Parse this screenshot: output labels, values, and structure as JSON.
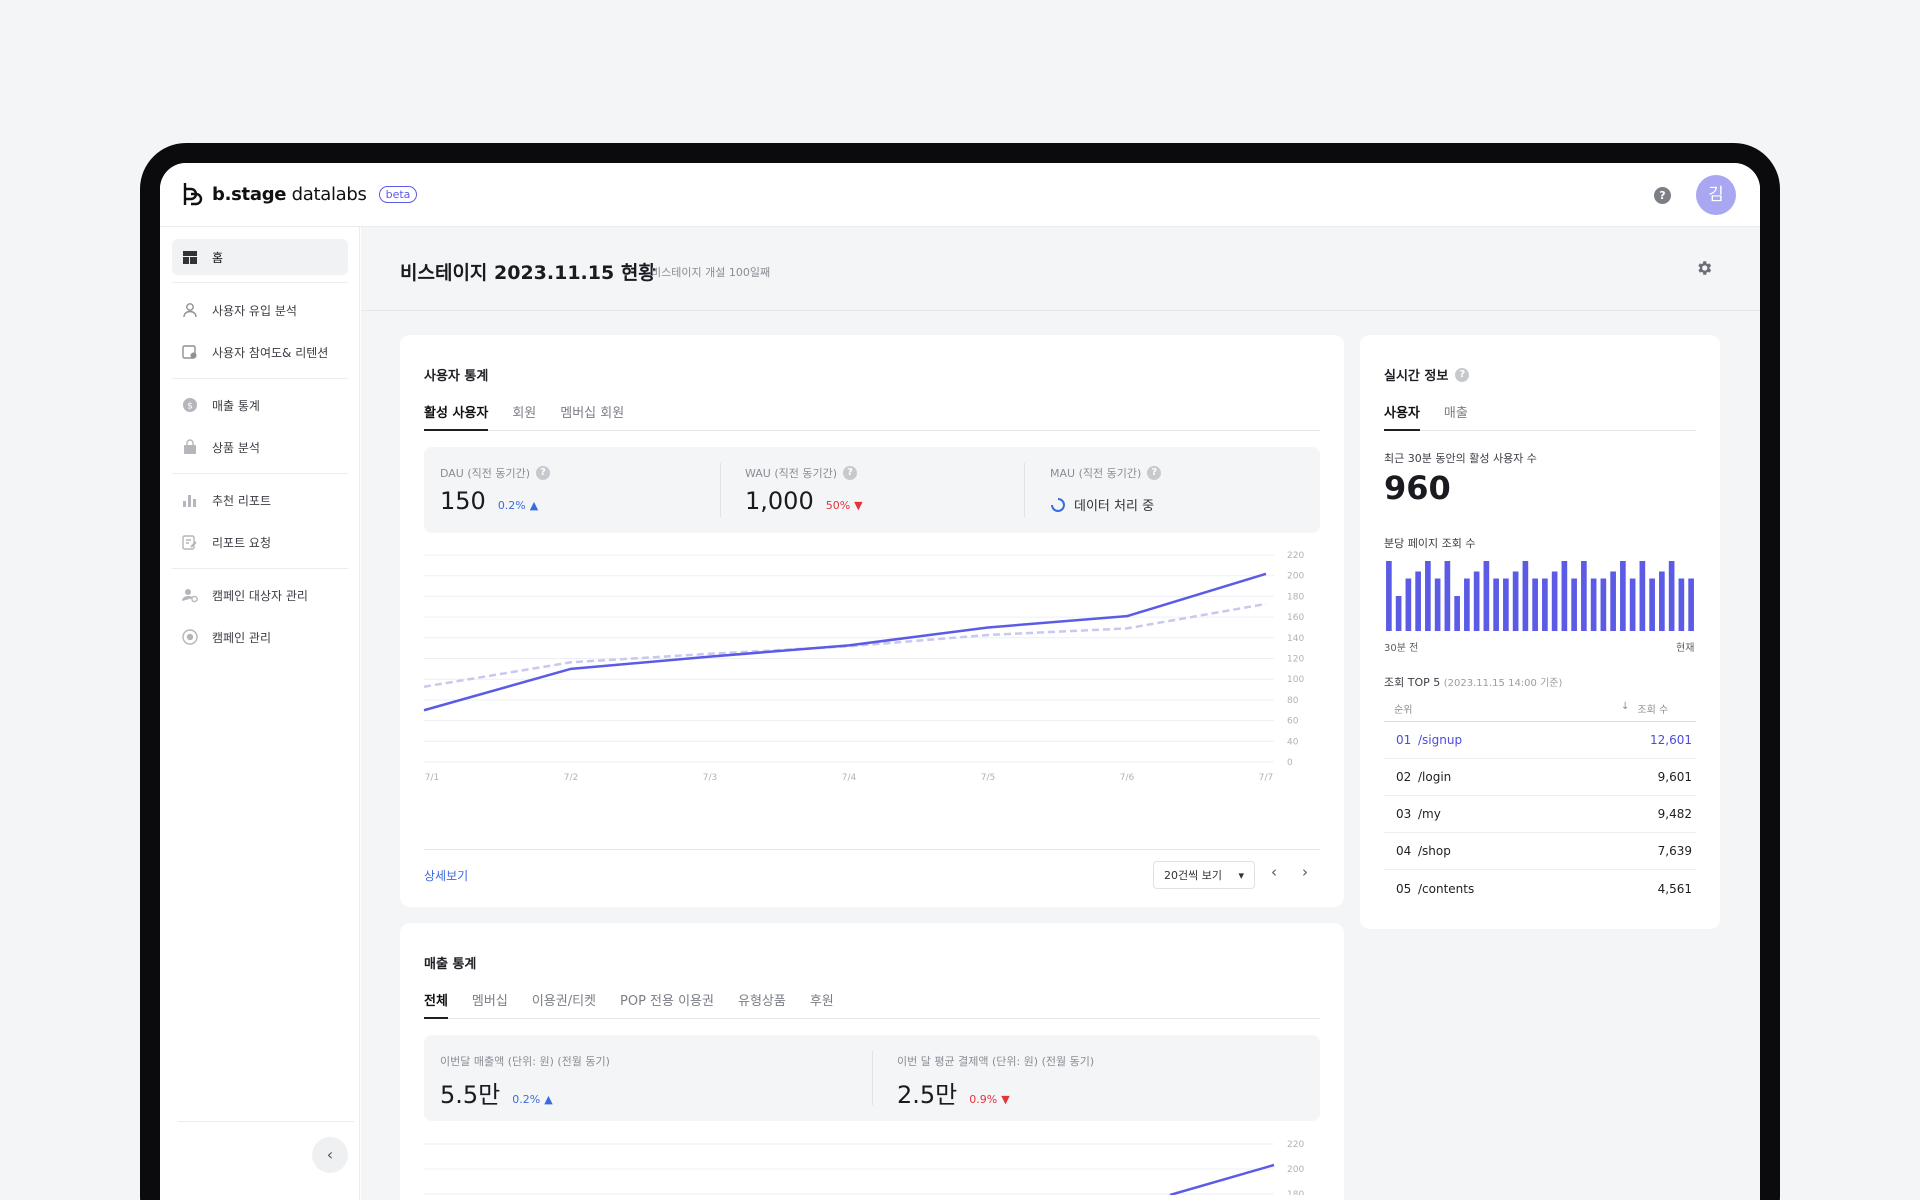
{
  "app": {
    "logo_brand": "b.stage",
    "logo_product": "datalabs",
    "beta_badge": "beta",
    "avatar_initial": "김",
    "help_icon": "?"
  },
  "sidebar": {
    "items": [
      {
        "label": "홈",
        "icon": "dashboard-icon"
      },
      {
        "label": "사용자 유입 분석",
        "icon": "user-icon"
      },
      {
        "label": "사용자 참여도& 리텐션",
        "icon": "calendar-user-icon"
      },
      {
        "label": "매출 통계",
        "icon": "coin-icon"
      },
      {
        "label": "상품 분석",
        "icon": "bag-icon"
      },
      {
        "label": "추천 리포트",
        "icon": "bar-chart-icon"
      },
      {
        "label": "리포트 요청",
        "icon": "report-edit-icon"
      },
      {
        "label": "캠페인 대상자 관리",
        "icon": "user-settings-icon"
      },
      {
        "label": "캠페인 관리",
        "icon": "target-icon"
      }
    ],
    "collapse_icon": "‹"
  },
  "header": {
    "title": "비스테이지 2023.11.15 현황",
    "subtitle": "비스테이지 개설 100일째"
  },
  "user_stats": {
    "title": "사용자 통계",
    "tabs": [
      "활성 사용자",
      "회원",
      "멤버십 회원"
    ],
    "dau": {
      "label": "DAU (직전 동기간)",
      "value": "150",
      "delta": "0.2%",
      "dir": "up"
    },
    "wau": {
      "label": "WAU (직전 동기간)",
      "value": "1,000",
      "delta": "50%",
      "dir": "down"
    },
    "mau": {
      "label": "MAU (직전 동기간)",
      "status": "데이터 처리 중"
    },
    "detail_link": "상세보기",
    "page_size": "20건씩 보기",
    "prev": "‹",
    "next": "›"
  },
  "chart_data": [
    {
      "type": "line",
      "x": [
        "7/1",
        "7/2",
        "7/3",
        "7/4",
        "7/5",
        "7/6",
        "7/7"
      ],
      "y_ticks": [
        "220",
        "200",
        "180",
        "160",
        "140",
        "120",
        "100",
        "80",
        "60",
        "40",
        "0"
      ],
      "series": [
        {
          "values": [
            55,
            99,
            112,
            124,
            143,
            155,
            200
          ],
          "color": "#5b5be6",
          "style": "solid"
        },
        {
          "values": [
            80,
            106,
            115,
            123,
            135,
            142,
            168
          ],
          "color": "#c8c8f0",
          "style": "dashed"
        }
      ],
      "grid": true
    },
    {
      "type": "bar",
      "categories_shown": [
        "30분 전",
        "현재"
      ],
      "values": [
        10,
        5,
        7.5,
        8.5,
        10,
        7.5,
        10,
        5,
        7.5,
        8.5,
        10,
        7.5,
        7.5,
        8.5,
        10,
        7.5,
        7.5,
        8.5,
        10,
        7.5,
        10,
        7.5,
        7.5,
        8.5,
        10,
        7.5,
        10,
        7.5,
        8.5,
        10,
        7.5,
        7.5
      ],
      "color": "#5b5be6"
    }
  ],
  "realtime": {
    "title": "실시간 정보",
    "tabs": [
      "사용자",
      "매출"
    ],
    "active_label": "최근 30분 동안의 활성 사용자 수",
    "active_value": "960",
    "pv_label": "분당 페이지 조회 수",
    "axis_start": "30분 전",
    "axis_end": "현재",
    "top5_title": "조회 TOP 5",
    "top5_note": "(2023.11.15 14:00 기준)",
    "col_rank": "순위",
    "col_count": "조회 수",
    "rows": [
      {
        "rank": "01",
        "page": "/signup",
        "count": "12,601"
      },
      {
        "rank": "02",
        "page": "/login",
        "count": "9,601"
      },
      {
        "rank": "03",
        "page": "/my",
        "count": "9,482"
      },
      {
        "rank": "04",
        "page": "/shop",
        "count": "7,639"
      },
      {
        "rank": "05",
        "page": "/contents",
        "count": "4,561"
      }
    ]
  },
  "sales_stats": {
    "title": "매출 통계",
    "tabs": [
      "전체",
      "멤버십",
      "이용권/티켓",
      "POP 전용 이용권",
      "유형상품",
      "후원"
    ],
    "monthly": {
      "label": "이번달 매출액 (단위: 원) (전월 동기)",
      "value": "5.5만",
      "delta": "0.2%",
      "dir": "up"
    },
    "avg": {
      "label": "이번 달 평균 결제액 (단위: 원) (전월 동기)",
      "value": "2.5만",
      "delta": "0.9%",
      "dir": "down"
    },
    "y_ticks": [
      "220",
      "200",
      "180"
    ]
  },
  "colors": {
    "accent": "#5b5be6",
    "up": "#3a6be0",
    "down": "#e5323b"
  }
}
